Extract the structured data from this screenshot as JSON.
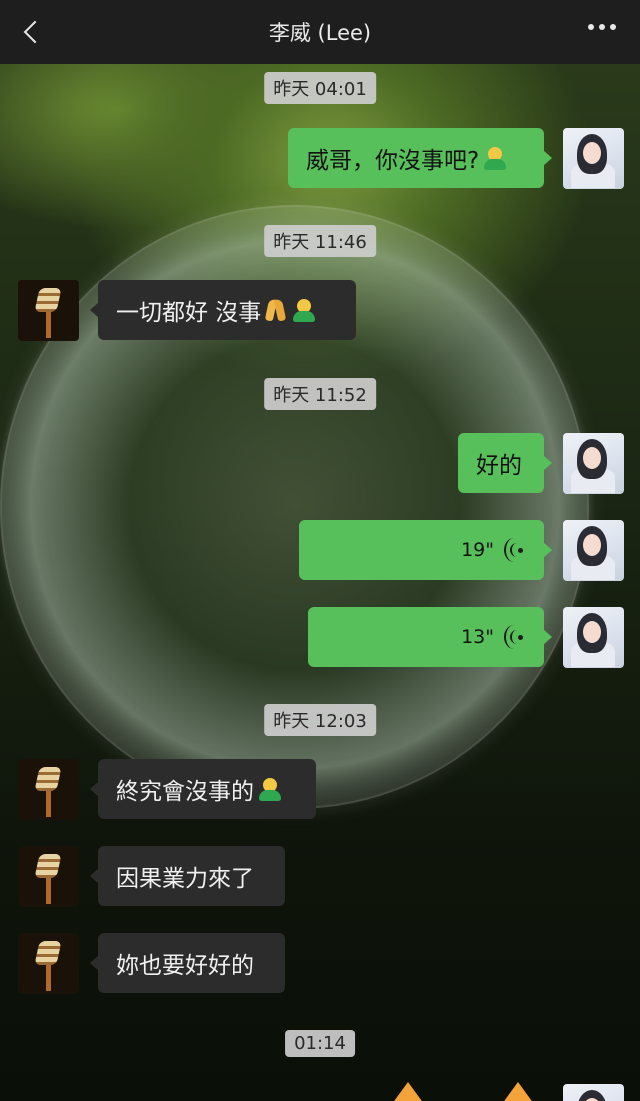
{
  "nav": {
    "title": "李威 (Lee)"
  },
  "timestamps": [
    "昨天 04:01",
    "昨天 11:46",
    "昨天 11:52",
    "昨天 12:03",
    "01:14"
  ],
  "messages": [
    {
      "from": "me",
      "text": "威哥，你沒事吧?"
    },
    {
      "from": "lee",
      "text": "一切都好 沒事"
    },
    {
      "from": "me",
      "text": "好的"
    },
    {
      "from": "me",
      "type": "voice",
      "duration": "19\""
    },
    {
      "from": "me",
      "type": "voice",
      "duration": "13\""
    },
    {
      "from": "lee",
      "text": "終究會沒事的"
    },
    {
      "from": "lee",
      "text": "因果業力來了"
    },
    {
      "from": "lee",
      "text": "妳也要好好的"
    }
  ],
  "colors": {
    "sent_bubble": "#57c05a",
    "recv_bubble": "#2c2c2c",
    "nav_bg": "#1e1e1e"
  },
  "icons": {
    "back": "chevron-left-icon",
    "more": "more-dots-icon",
    "voice": "voice-wave-icon",
    "emoji_person": "person-emoji-icon",
    "emoji_pray": "folded-hands-emoji-icon"
  }
}
